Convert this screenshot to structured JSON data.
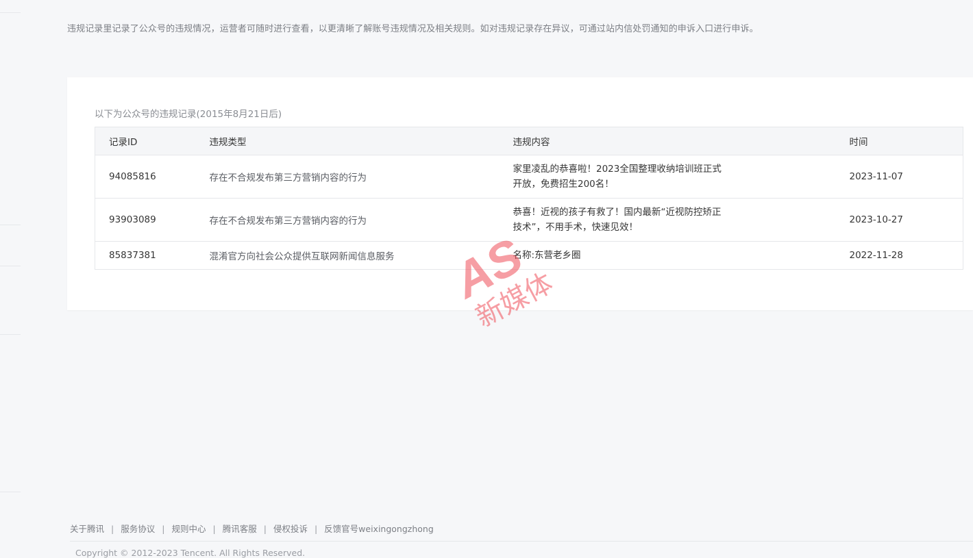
{
  "intro": "违规记录里记录了公众号的违规情况，运营者可随时进行查看，以更清晰了解账号违规情况及相关规则。如对违规记录存在异议，可通过站内信处罚通知的申诉入口进行申诉。",
  "records": {
    "caption": "以下为公众号的违规记录(2015年8月21日后)",
    "headers": {
      "id": "记录ID",
      "type": "违规类型",
      "content": "违规内容",
      "time": "时间"
    },
    "rows": [
      {
        "id": "94085816",
        "type": "存在不合规发布第三方营销内容的行为",
        "content": "家里凌乱的恭喜啦！2023全国整理收纳培训班正式开放，免费招生200名！",
        "time": "2023-11-07"
      },
      {
        "id": "93903089",
        "type": "存在不合规发布第三方营销内容的行为",
        "content": "恭喜！近视的孩子有救了！国内最新“近视防控矫正技术”，不用手术，快速见效！",
        "time": "2023-10-27"
      },
      {
        "id": "85837381",
        "type": "混淆官方向社会公众提供互联网新闻信息服务",
        "content": "名称:东营老乡圈",
        "time": "2022-11-28"
      }
    ]
  },
  "footer": {
    "links": [
      "关于腾讯",
      "服务协议",
      "规则中心",
      "腾讯客服",
      "侵权投诉",
      "反馈官号weixingongzhong"
    ],
    "copyright": "Copyright © 2012-2023 Tencent. All Rights Reserved."
  },
  "watermark": {
    "logo_text": "AS",
    "brand_text": "新媒体",
    "color": "#f0505a"
  }
}
